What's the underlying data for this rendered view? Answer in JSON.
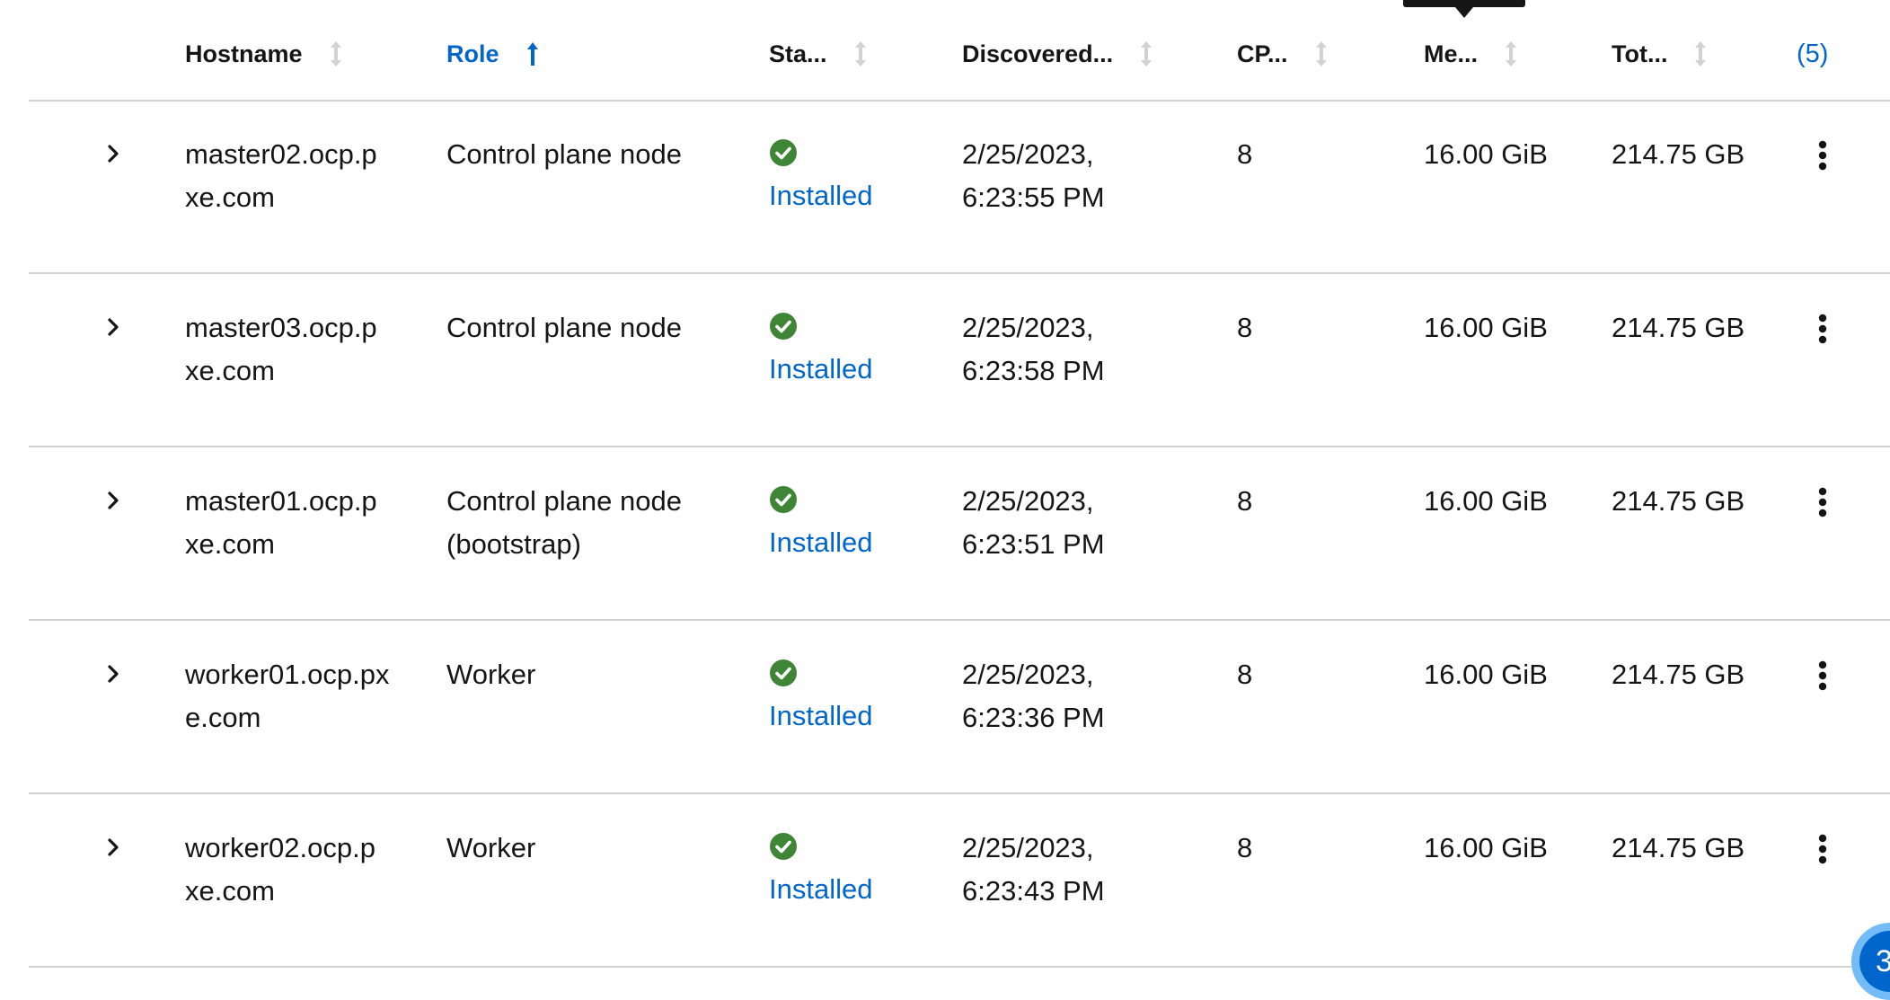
{
  "table": {
    "columns": [
      {
        "key": "hostname",
        "label": "Hostname",
        "sort": "none"
      },
      {
        "key": "role",
        "label": "Role",
        "sort": "ascending"
      },
      {
        "key": "status",
        "label": "Sta...",
        "sort": "none"
      },
      {
        "key": "discovered",
        "label": "Discovered...",
        "sort": "none"
      },
      {
        "key": "cpu",
        "label": "CP...",
        "sort": "none"
      },
      {
        "key": "memory",
        "label": "Me...",
        "sort": "none"
      },
      {
        "key": "disk",
        "label": "Tot...",
        "sort": "none"
      }
    ],
    "column_count_label": "(5)",
    "rows": [
      {
        "hostname_line1": "master02.ocp.p",
        "hostname_line2": "xe.com",
        "role_line1": "Control plane node",
        "role_line2": "",
        "status": "Installed",
        "discovered_line1": "2/25/2023,",
        "discovered_line2": "6:23:55 PM",
        "cpu": "8",
        "memory": "16.00 GiB",
        "disk": "214.75 GB"
      },
      {
        "hostname_line1": "master03.ocp.p",
        "hostname_line2": "xe.com",
        "role_line1": "Control plane node",
        "role_line2": "",
        "status": "Installed",
        "discovered_line1": "2/25/2023,",
        "discovered_line2": "6:23:58 PM",
        "cpu": "8",
        "memory": "16.00 GiB",
        "disk": "214.75 GB"
      },
      {
        "hostname_line1": "master01.ocp.p",
        "hostname_line2": "xe.com",
        "role_line1": "Control plane node",
        "role_line2": "(bootstrap)",
        "status": "Installed",
        "discovered_line1": "2/25/2023,",
        "discovered_line2": "6:23:51 PM",
        "cpu": "8",
        "memory": "16.00 GiB",
        "disk": "214.75 GB"
      },
      {
        "hostname_line1": "worker01.ocp.px",
        "hostname_line2": "e.com",
        "role_line1": "Worker",
        "role_line2": "",
        "status": "Installed",
        "discovered_line1": "2/25/2023,",
        "discovered_line2": "6:23:36 PM",
        "cpu": "8",
        "memory": "16.00 GiB",
        "disk": "214.75 GB"
      },
      {
        "hostname_line1": "worker02.ocp.p",
        "hostname_line2": "xe.com",
        "role_line1": "Worker",
        "role_line2": "",
        "status": "Installed",
        "discovered_line1": "2/25/2023,",
        "discovered_line2": "6:23:43 PM",
        "cpu": "8",
        "memory": "16.00 GiB",
        "disk": "214.75 GB"
      }
    ]
  },
  "icons": {
    "expand": "chevron-right-icon",
    "status": "check-circle-icon",
    "row_actions": "kebab-icon",
    "sort_inactive": "sort-icon",
    "sort_active": "sort-ascending-icon"
  },
  "colors": {
    "link": "#0066cc",
    "success": "#3e8635",
    "border": "#d2d2d2",
    "text": "#151515"
  },
  "fab": {
    "label": "3"
  }
}
